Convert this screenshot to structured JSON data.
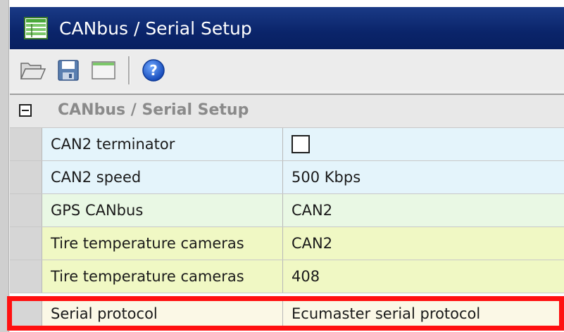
{
  "window": {
    "title": "CANbus / Serial Setup"
  },
  "toolbar": {
    "buttons": [
      {
        "name": "open-folder-icon"
      },
      {
        "name": "save-disk-icon"
      },
      {
        "name": "window-icon"
      },
      {
        "name": "help-icon"
      }
    ]
  },
  "grid": {
    "category": {
      "label": "CANbus / Serial Setup",
      "expanded": true
    },
    "rows": [
      {
        "name": "CAN2 terminator",
        "value": "",
        "type": "checkbox",
        "checked": false,
        "color": "#e4f4fb"
      },
      {
        "name": "CAN2 speed",
        "value": "500 Kbps",
        "type": "text",
        "color": "#e4f4fb"
      },
      {
        "name": "GPS CANbus",
        "value": "CAN2",
        "type": "text",
        "color": "#e9f8e4"
      },
      {
        "name": "Tire temperature cameras",
        "value": "CAN2",
        "type": "text",
        "color": "#f0f8c4"
      },
      {
        "name": "Tire temperature cameras",
        "value": "408",
        "type": "text",
        "color": "#f0f8c4"
      },
      {
        "name": "Serial protocol",
        "value": "Ecumaster serial protocol",
        "type": "text",
        "color": "#fbf8e6"
      }
    ]
  },
  "colors": {
    "titlebar": "#0a246a",
    "highlight": "#ff1010"
  }
}
